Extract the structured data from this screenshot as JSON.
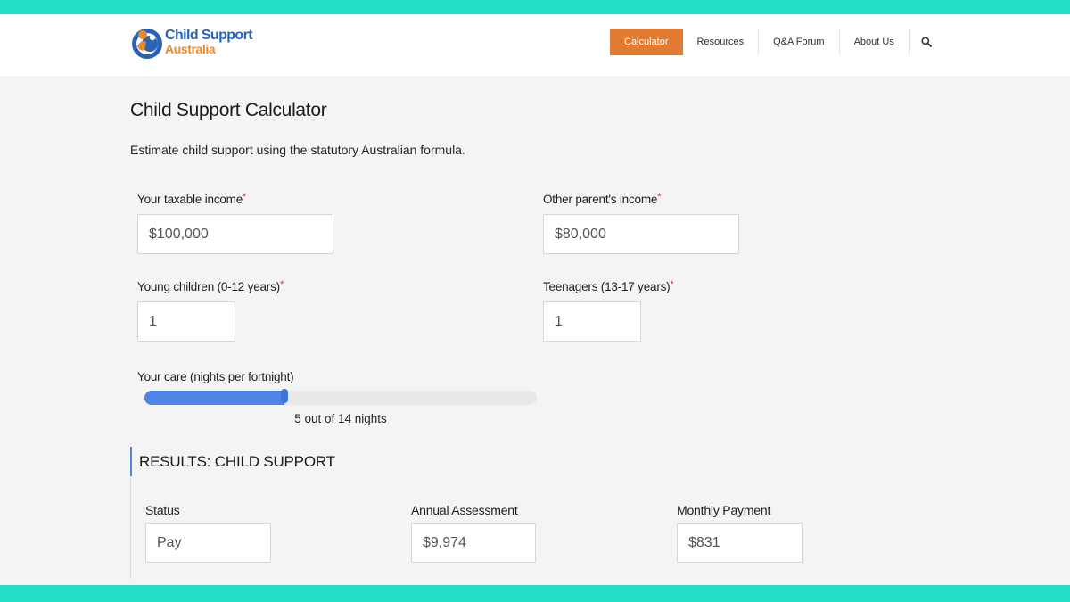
{
  "colors": {
    "accent_band": "#25e0c8",
    "nav_active": "#e07b32",
    "logo_blue": "#2b63b4",
    "logo_orange": "#e98a2a",
    "slider_fill": "#4d86e8",
    "required_mark": "#d9342b"
  },
  "header": {
    "logo": {
      "line1": "Child Support",
      "line2": "Australia",
      "icon": "family-logo-icon"
    },
    "nav": [
      {
        "label": "Calculator",
        "active": true
      },
      {
        "label": "Resources",
        "active": false
      },
      {
        "label": "Q&A Forum",
        "active": false
      },
      {
        "label": "About Us",
        "active": false
      }
    ],
    "search_icon": "search-icon"
  },
  "page": {
    "title": "Child Support Calculator",
    "description": "Estimate child support using the statutory Australian formula."
  },
  "form": {
    "your_income": {
      "label": "Your taxable income",
      "required_mark": "*",
      "value": "$100,000"
    },
    "other_income": {
      "label": "Other parent's income",
      "required_mark": "*",
      "value": "$80,000"
    },
    "young_children": {
      "label": "Young children (0-12 years)",
      "required_mark": "*",
      "value": "1"
    },
    "teenagers": {
      "label": "Teenagers (13-17 years)",
      "required_mark": "*",
      "value": "1"
    },
    "care": {
      "label": "Your care (nights per fortnight)",
      "value": 5,
      "max": 14,
      "caption": "5 out of 14 nights"
    }
  },
  "results": {
    "title": "RESULTS: CHILD SUPPORT",
    "status": {
      "label": "Status",
      "value": "Pay"
    },
    "annual": {
      "label": "Annual Assessment",
      "value": "$9,974"
    },
    "monthly": {
      "label": "Monthly Payment",
      "value": "$831"
    }
  }
}
